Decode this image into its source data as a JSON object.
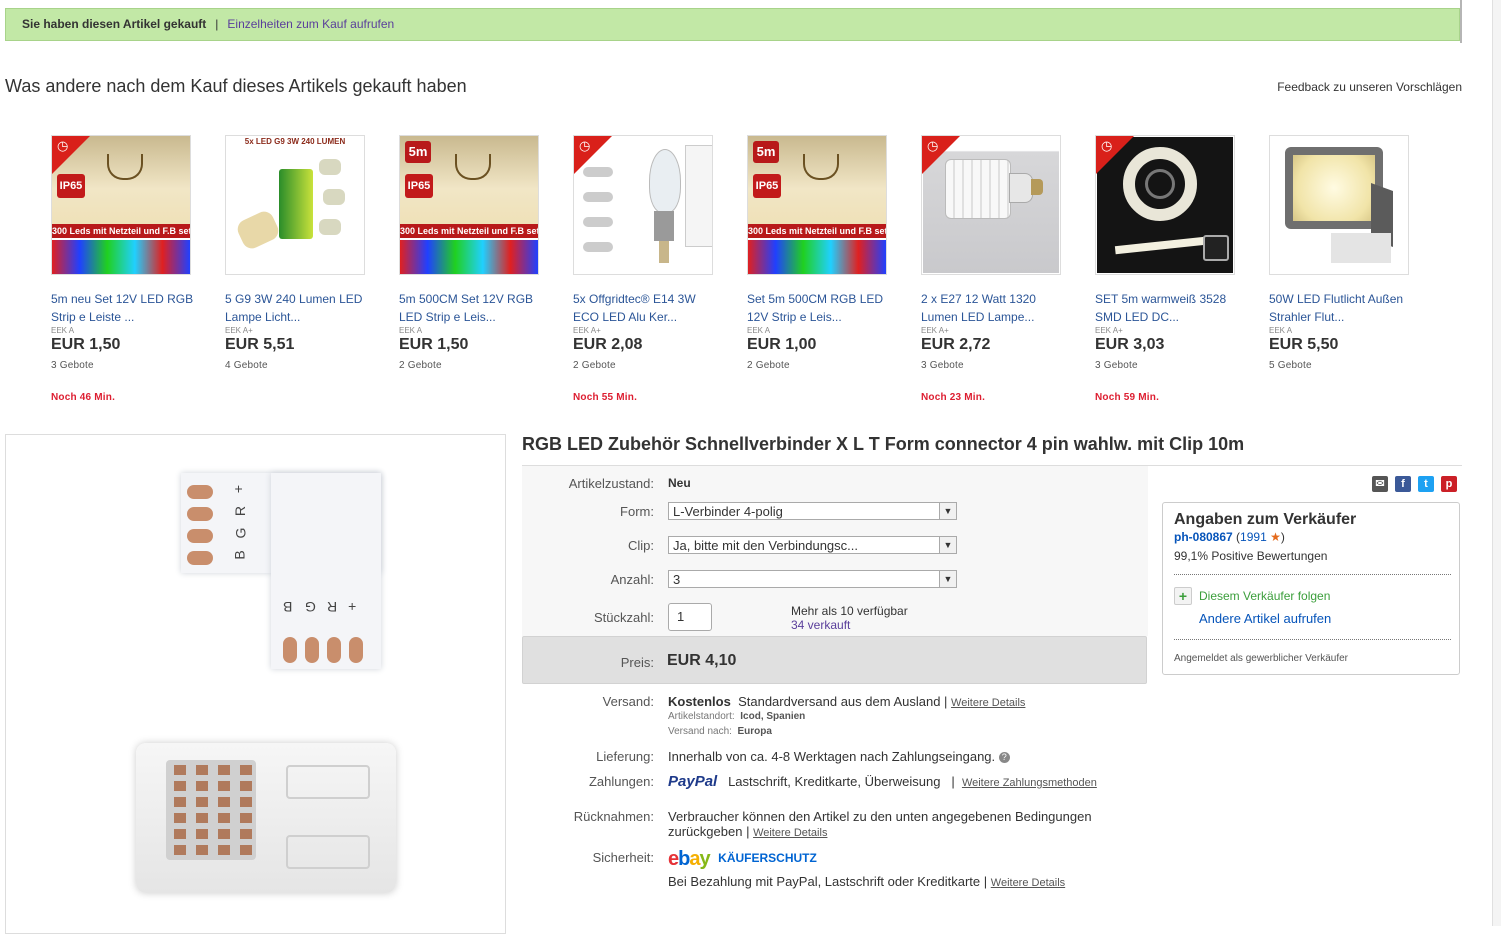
{
  "purchase_bar": {
    "text": "Sie haben diesen Artikel gekauft",
    "separator": "|",
    "link": "Einzelheiten zum Kauf aufrufen"
  },
  "recommendations": {
    "title": "Was andere nach dem Kauf dieses Artikels gekauft haben",
    "feedback": "Feedback zu unseren Vorschlägen",
    "items": [
      {
        "title": "5m neu Set 12V LED RGB Strip e Leiste ...",
        "eek": "EEK A",
        "price": "EUR 1,50",
        "bids": "3 Gebote",
        "time_left": "Noch 46 Min.",
        "banner": "300 Leds mit Netzteil und F.B set",
        "badge": "IP65"
      },
      {
        "title": "5 G9 3W 240 Lumen LED Lampe Licht...",
        "eek": "EEK A+",
        "price": "EUR 5,51",
        "bids": "4 Gebote",
        "time_left": "",
        "banner": "5x LED G9 3W 240 LUMEN"
      },
      {
        "title": "5m 500CM Set 12V RGB LED Strip e Leis...",
        "eek": "EEK A",
        "price": "EUR 1,50",
        "bids": "2 Gebote",
        "time_left": "",
        "banner": "300 Leds mit Netzteil und F.B set",
        "badge": "IP65",
        "badge2": "5m"
      },
      {
        "title": "5x Offgridtec® E14 3W ECO LED Alu Ker...",
        "eek": "EEK A+",
        "price": "EUR 2,08",
        "bids": "2 Gebote",
        "time_left": "Noch 55 Min."
      },
      {
        "title": "Set 5m 500CM RGB LED 12V Strip e Leis...",
        "eek": "EEK A",
        "price": "EUR 1,00",
        "bids": "2 Gebote",
        "time_left": "",
        "banner": "300 Leds mit Netzteil und F.B set",
        "badge": "IP65",
        "badge2": "5m"
      },
      {
        "title": "2 x E27 12 Watt 1320 Lumen LED Lampe...",
        "eek": "EEK A+",
        "price": "EUR 2,72",
        "bids": "3 Gebote",
        "time_left": "Noch 23 Min."
      },
      {
        "title": "SET 5m warmweiß 3528 SMD LED DC...",
        "eek": "EEK A+",
        "price": "EUR 3,03",
        "bids": "3 Gebote",
        "time_left": "Noch 59 Min."
      },
      {
        "title": "50W LED Flutlicht Außen Strahler Flut...",
        "eek": "EEK A",
        "price": "EUR 5,50",
        "bids": "5 Gebote",
        "time_left": ""
      }
    ]
  },
  "product": {
    "title": "RGB LED Zubehör Schnellverbinder X L T Form connector 4 pin wahlw. mit Clip 10m",
    "condition_label": "Artikelzustand:",
    "condition": "Neu",
    "form_label": "Form:",
    "form_value": "L-Verbinder 4-polig",
    "clip_label": "Clip:",
    "clip_value": "Ja, bitte mit den Verbindungsc...",
    "anzahl_label": "Anzahl:",
    "anzahl_value": "3",
    "qty_label": "Stückzahl:",
    "qty_value": "1",
    "available": "Mehr als 10 verfügbar",
    "sold": "34 verkauft",
    "price_label": "Preis:",
    "price": "EUR 4,10",
    "shipping_label": "Versand:",
    "shipping_free": "Kostenlos",
    "shipping_method": "Standardversand aus dem Ausland",
    "more_details": "Weitere Details",
    "location_label": "Artikelstandort:",
    "location": "Icod, Spanien",
    "ship_to_label": "Versand nach:",
    "ship_to": "Europa",
    "delivery_label": "Lieferung:",
    "delivery": "Innerhalb von ca. 4-8 Werktagen nach Zahlungseingang.",
    "payment_label": "Zahlungen:",
    "paypal": "PayPal",
    "payment_methods": "Lastschrift,  Kreditkarte,  Überweisung",
    "more_payment": "Weitere Zahlungsmethoden",
    "returns_label": "Rücknahmen:",
    "returns_line1": "Verbraucher können den Artikel zu den unten angegebenen Bedingungen",
    "returns_line2": "zurückgeben",
    "security_label": "Sicherheit:",
    "buyer_protection": "KÄUFERSCHUTZ",
    "security_text": "Bei Bezahlung mit PayPal, Lastschrift oder Kreditkarte",
    "ebay_logo": [
      "e",
      "b",
      "a",
      "y"
    ]
  },
  "connector_labels": {
    "top": [
      "+",
      "R",
      "G",
      "B"
    ],
    "bottom": [
      "B",
      "G",
      "R",
      "+"
    ]
  },
  "seller": {
    "heading": "Angaben zum Verkäufer",
    "name": "ph-080867",
    "score": "1991",
    "positive": "99,1% Positive Bewertungen",
    "follow": "Diesem Verkäufer folgen",
    "other_items": "Andere Artikel aufrufen",
    "business": "Angemeldet als gewerblicher Verkäufer"
  },
  "colors": {
    "link_blue": "#2b5597",
    "time_red": "#dd1e31",
    "bar_green": "#c2e8a6"
  },
  "icons": [
    "clock-icon",
    "mail-icon",
    "facebook-icon",
    "twitter-icon",
    "pinterest-icon",
    "star-icon",
    "plus-icon",
    "help-icon",
    "select-arrow-icon"
  ]
}
